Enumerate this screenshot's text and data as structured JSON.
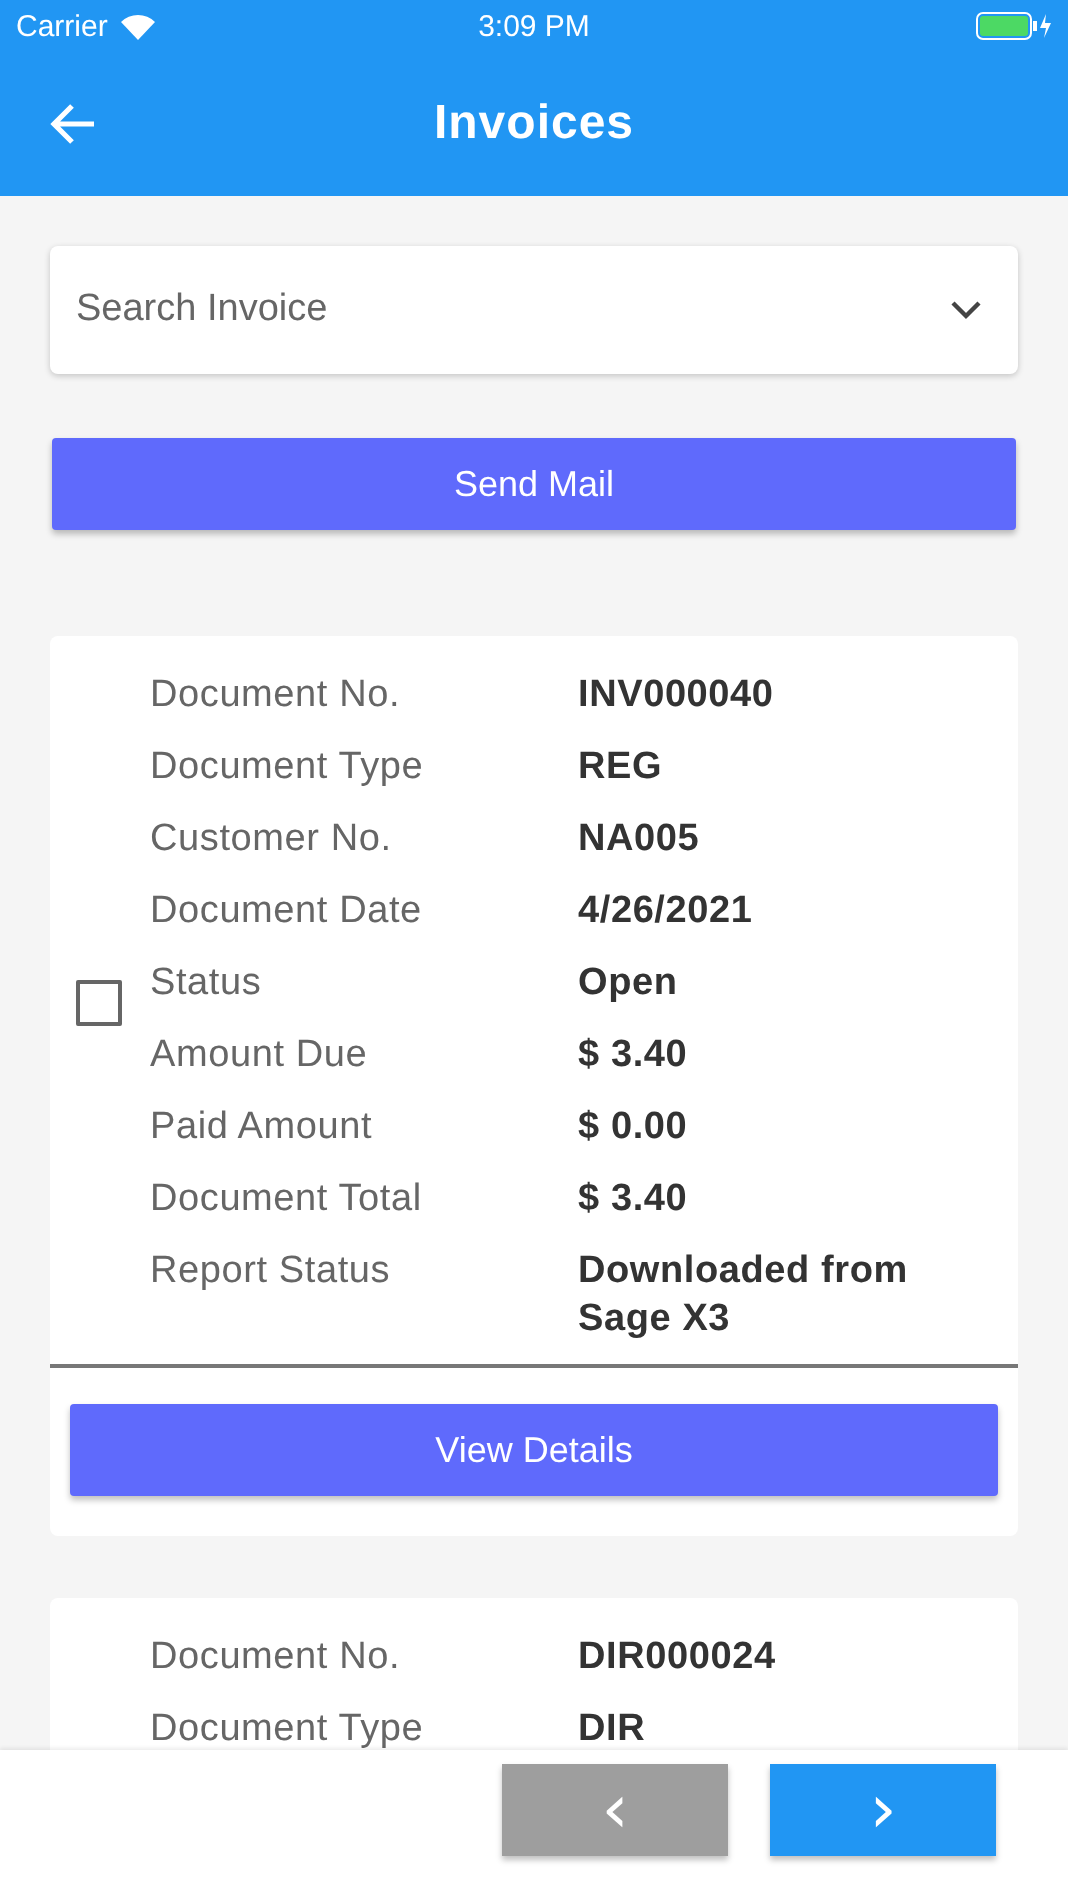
{
  "status_bar": {
    "carrier": "Carrier",
    "time": "3:09 PM"
  },
  "app_bar": {
    "title": "Invoices"
  },
  "search": {
    "placeholder": "Search Invoice"
  },
  "send_button": "Send Mail",
  "invoices": [
    {
      "checked": false,
      "fields": [
        {
          "label": "Document No.",
          "value": "INV000040"
        },
        {
          "label": "Document Type",
          "value": "REG"
        },
        {
          "label": "Customer No.",
          "value": "NA005"
        },
        {
          "label": "Document Date",
          "value": "4/26/2021"
        },
        {
          "label": "Status",
          "value": "Open"
        },
        {
          "label": "Amount Due",
          "value": "$ 3.40"
        },
        {
          "label": "Paid Amount",
          "value": "$ 0.00"
        },
        {
          "label": "Document Total",
          "value": "$ 3.40"
        },
        {
          "label": "Report Status",
          "value": "Downloaded from Sage X3"
        }
      ],
      "button": "View Details"
    },
    {
      "fields": [
        {
          "label": "Document No.",
          "value": "DIR000024"
        },
        {
          "label": "Document Type",
          "value": "DIR"
        }
      ]
    }
  ],
  "pager": [
    {
      "symbol": "‹",
      "disabled": true
    },
    {
      "symbol": "›",
      "disabled": false
    }
  ]
}
